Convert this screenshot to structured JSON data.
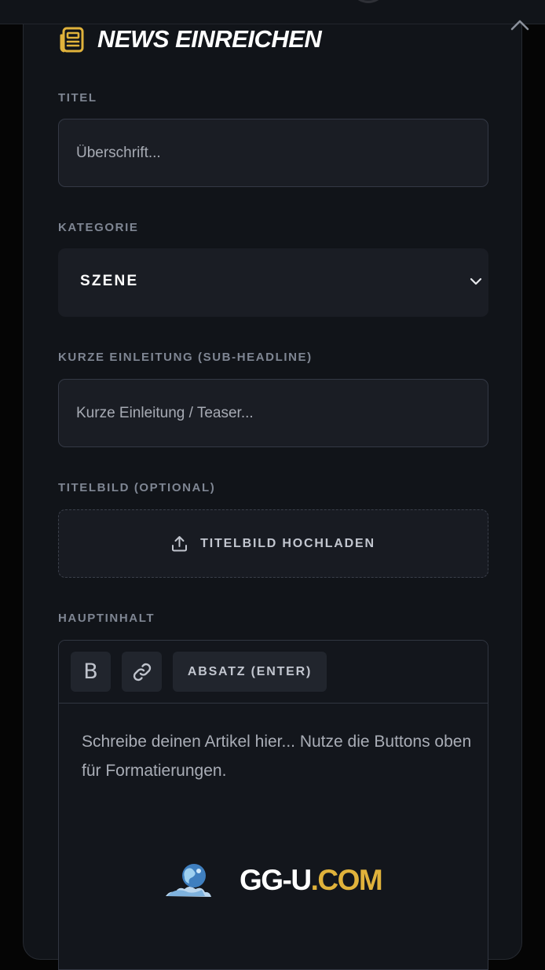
{
  "header": {
    "title": "NEWS EINREICHEN",
    "icon": "newspaper-icon",
    "collapse_icon": "chevron-up-icon"
  },
  "form": {
    "title_label": "TITEL",
    "title_placeholder": "Überschrift...",
    "title_value": "",
    "category_label": "KATEGORIE",
    "category_value": "SZENE",
    "intro_label": "KURZE EINLEITUNG (SUB-HEADLINE)",
    "intro_placeholder": "Kurze Einleitung / Teaser...",
    "intro_value": "",
    "image_label": "TITELBILD (OPTIONAL)",
    "image_button": "TITELBILD HOCHLADEN",
    "content_label": "HAUPTINHALT"
  },
  "editor": {
    "bold_label": "B",
    "paragraph_label": "ABSATZ (ENTER)",
    "placeholder": "Schreibe deinen Artikel hier... Nutze die Buttons oben für Formatierungen."
  },
  "watermark": {
    "brand_white": "GG-U",
    "brand_gold": ".COM"
  },
  "colors": {
    "background": "#050505",
    "panel": "#111419",
    "field": "#1a1d24",
    "accent_gold": "#e0b23b",
    "label_gray": "#7f8693"
  }
}
